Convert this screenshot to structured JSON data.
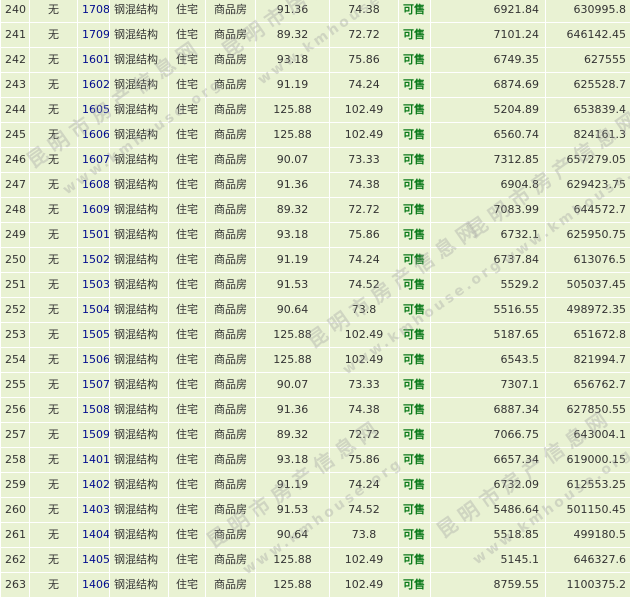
{
  "rows": [
    {
      "idx": "240",
      "floor": "无",
      "room": "1708",
      "structure": "钢混结构",
      "use": "住宅",
      "type": "商品房",
      "area1": "91.36",
      "area2": "74.38",
      "status": "可售",
      "price": "6921.84",
      "total": "630995.8"
    },
    {
      "idx": "241",
      "floor": "无",
      "room": "1709",
      "structure": "钢混结构",
      "use": "住宅",
      "type": "商品房",
      "area1": "89.32",
      "area2": "72.72",
      "status": "可售",
      "price": "7101.24",
      "total": "646142.45"
    },
    {
      "idx": "242",
      "floor": "无",
      "room": "1601",
      "structure": "钢混结构",
      "use": "住宅",
      "type": "商品房",
      "area1": "93.18",
      "area2": "75.86",
      "status": "可售",
      "price": "6749.35",
      "total": "627555"
    },
    {
      "idx": "243",
      "floor": "无",
      "room": "1602",
      "structure": "钢混结构",
      "use": "住宅",
      "type": "商品房",
      "area1": "91.19",
      "area2": "74.24",
      "status": "可售",
      "price": "6874.69",
      "total": "625528.7"
    },
    {
      "idx": "244",
      "floor": "无",
      "room": "1605",
      "structure": "钢混结构",
      "use": "住宅",
      "type": "商品房",
      "area1": "125.88",
      "area2": "102.49",
      "status": "可售",
      "price": "5204.89",
      "total": "653839.4"
    },
    {
      "idx": "245",
      "floor": "无",
      "room": "1606",
      "structure": "钢混结构",
      "use": "住宅",
      "type": "商品房",
      "area1": "125.88",
      "area2": "102.49",
      "status": "可售",
      "price": "6560.74",
      "total": "824161.3"
    },
    {
      "idx": "246",
      "floor": "无",
      "room": "1607",
      "structure": "钢混结构",
      "use": "住宅",
      "type": "商品房",
      "area1": "90.07",
      "area2": "73.33",
      "status": "可售",
      "price": "7312.85",
      "total": "657279.05"
    },
    {
      "idx": "247",
      "floor": "无",
      "room": "1608",
      "structure": "钢混结构",
      "use": "住宅",
      "type": "商品房",
      "area1": "91.36",
      "area2": "74.38",
      "status": "可售",
      "price": "6904.8",
      "total": "629423.75"
    },
    {
      "idx": "248",
      "floor": "无",
      "room": "1609",
      "structure": "钢混结构",
      "use": "住宅",
      "type": "商品房",
      "area1": "89.32",
      "area2": "72.72",
      "status": "可售",
      "price": "7083.99",
      "total": "644572.7"
    },
    {
      "idx": "249",
      "floor": "无",
      "room": "1501",
      "structure": "钢混结构",
      "use": "住宅",
      "type": "商品房",
      "area1": "93.18",
      "area2": "75.86",
      "status": "可售",
      "price": "6732.1",
      "total": "625950.75"
    },
    {
      "idx": "250",
      "floor": "无",
      "room": "1502",
      "structure": "钢混结构",
      "use": "住宅",
      "type": "商品房",
      "area1": "91.19",
      "area2": "74.24",
      "status": "可售",
      "price": "6737.84",
      "total": "613076.5"
    },
    {
      "idx": "251",
      "floor": "无",
      "room": "1503",
      "structure": "钢混结构",
      "use": "住宅",
      "type": "商品房",
      "area1": "91.53",
      "area2": "74.52",
      "status": "可售",
      "price": "5529.2",
      "total": "505037.45"
    },
    {
      "idx": "252",
      "floor": "无",
      "room": "1504",
      "structure": "钢混结构",
      "use": "住宅",
      "type": "商品房",
      "area1": "90.64",
      "area2": "73.8",
      "status": "可售",
      "price": "5516.55",
      "total": "498972.35"
    },
    {
      "idx": "253",
      "floor": "无",
      "room": "1505",
      "structure": "钢混结构",
      "use": "住宅",
      "type": "商品房",
      "area1": "125.88",
      "area2": "102.49",
      "status": "可售",
      "price": "5187.65",
      "total": "651672.8"
    },
    {
      "idx": "254",
      "floor": "无",
      "room": "1506",
      "structure": "钢混结构",
      "use": "住宅",
      "type": "商品房",
      "area1": "125.88",
      "area2": "102.49",
      "status": "可售",
      "price": "6543.5",
      "total": "821994.7"
    },
    {
      "idx": "255",
      "floor": "无",
      "room": "1507",
      "structure": "钢混结构",
      "use": "住宅",
      "type": "商品房",
      "area1": "90.07",
      "area2": "73.33",
      "status": "可售",
      "price": "7307.1",
      "total": "656762.7"
    },
    {
      "idx": "256",
      "floor": "无",
      "room": "1508",
      "structure": "钢混结构",
      "use": "住宅",
      "type": "商品房",
      "area1": "91.36",
      "area2": "74.38",
      "status": "可售",
      "price": "6887.34",
      "total": "627850.55"
    },
    {
      "idx": "257",
      "floor": "无",
      "room": "1509",
      "structure": "钢混结构",
      "use": "住宅",
      "type": "商品房",
      "area1": "89.32",
      "area2": "72.72",
      "status": "可售",
      "price": "7066.75",
      "total": "643004.1"
    },
    {
      "idx": "258",
      "floor": "无",
      "room": "1401",
      "structure": "钢混结构",
      "use": "住宅",
      "type": "商品房",
      "area1": "93.18",
      "area2": "75.86",
      "status": "可售",
      "price": "6657.34",
      "total": "619000.15"
    },
    {
      "idx": "259",
      "floor": "无",
      "room": "1402",
      "structure": "钢混结构",
      "use": "住宅",
      "type": "商品房",
      "area1": "91.19",
      "area2": "74.24",
      "status": "可售",
      "price": "6732.09",
      "total": "612553.25"
    },
    {
      "idx": "260",
      "floor": "无",
      "room": "1403",
      "structure": "钢混结构",
      "use": "住宅",
      "type": "商品房",
      "area1": "91.53",
      "area2": "74.52",
      "status": "可售",
      "price": "5486.64",
      "total": "501150.45"
    },
    {
      "idx": "261",
      "floor": "无",
      "room": "1404",
      "structure": "钢混结构",
      "use": "住宅",
      "type": "商品房",
      "area1": "90.64",
      "area2": "73.8",
      "status": "可售",
      "price": "5518.85",
      "total": "499180.5"
    },
    {
      "idx": "262",
      "floor": "无",
      "room": "1405",
      "structure": "钢混结构",
      "use": "住宅",
      "type": "商品房",
      "area1": "125.88",
      "area2": "102.49",
      "status": "可售",
      "price": "5145.1",
      "total": "646327.6"
    },
    {
      "idx": "263",
      "floor": "无",
      "room": "1406",
      "structure": "钢混结构",
      "use": "住宅",
      "type": "商品房",
      "area1": "125.88",
      "area2": "102.49",
      "status": "可售",
      "price": "8759.55",
      "total": "1100375.2"
    }
  ],
  "watermark": {
    "cn": "昆明市房产信息网",
    "en": "www.kmhouse.org"
  },
  "colors": {
    "background": "#e9f2d3",
    "room_link": "#000a8f",
    "status_available": "#0a7a1a"
  }
}
